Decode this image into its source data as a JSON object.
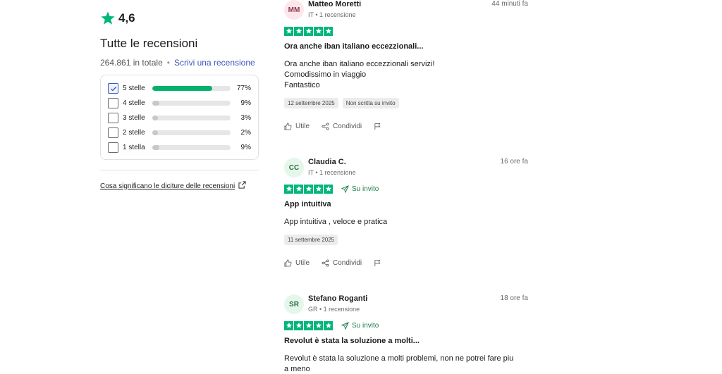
{
  "summary": {
    "rating": "4,6",
    "title": "Tutte le recensioni",
    "total": "264.861 in totale",
    "separator": "•",
    "write_link": "Scrivi una recensione",
    "filters": [
      {
        "label": "5 stelle",
        "percent": "77%",
        "fill": 0.77,
        "checked": true
      },
      {
        "label": "4 stelle",
        "percent": "9%",
        "fill": 0.09,
        "checked": false
      },
      {
        "label": "3 stelle",
        "percent": "3%",
        "fill": 0.03,
        "checked": false
      },
      {
        "label": "2 stelle",
        "percent": "2%",
        "fill": 0.02,
        "checked": false
      },
      {
        "label": "1 stella",
        "percent": "9%",
        "fill": 0.09,
        "checked": false
      }
    ],
    "meaning_link": "Cosa significano le diciture delle recensioni"
  },
  "colors": {
    "trustpilot_green": "#00b67a",
    "link_blue": "#3c57bc",
    "invited_green": "#1d7b4c"
  },
  "reviews": [
    {
      "initials": "MM",
      "avatar_bg": "#fde7ec",
      "avatar_fg": "#8a3a4a",
      "name": "Matteo Moretti",
      "meta": "IT • 1 recensione",
      "time": "44 minuti fa",
      "stars": 5,
      "invited": "",
      "title": "Ora anche iban italiano eccezzionali...",
      "body": [
        "Ora anche iban italiano eccezzionali servizi!",
        "Comodissimo in viaggio",
        "Fantastico"
      ],
      "tags": [
        "12 settembre 2025",
        "Non scritta su invito"
      ]
    },
    {
      "initials": "CC",
      "avatar_bg": "#e4f7ea",
      "avatar_fg": "#2d6b43",
      "name": "Claudia C.",
      "meta": "IT • 1 recensione",
      "time": "16 ore fa",
      "stars": 5,
      "invited": "Su invito",
      "title": "App intuitiva",
      "body": [
        "App intuitiva , veloce e pratica"
      ],
      "tags": [
        "11 settembre 2025"
      ]
    },
    {
      "initials": "SR",
      "avatar_bg": "#e4f7ea",
      "avatar_fg": "#2d6b43",
      "name": "Stefano Roganti",
      "meta": "GR • 1 recensione",
      "time": "18 ore fa",
      "stars": 5,
      "invited": "Su invito",
      "title": "Revolut è stata la soluzione a molti...",
      "body": [
        "Revolut è stata la soluzione a molti problemi, non ne potrei fare piu",
        "a meno"
      ],
      "tags": []
    }
  ],
  "actions": {
    "useful": "Utile",
    "share": "Condividi"
  }
}
